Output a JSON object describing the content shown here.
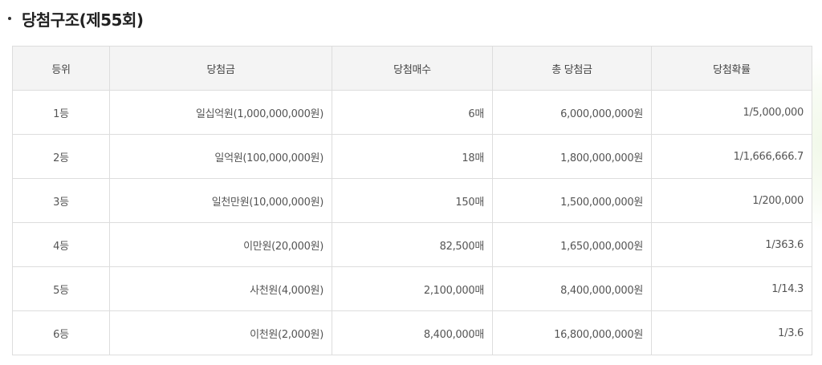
{
  "title": "당첨구조(제55회)",
  "columns": [
    "등위",
    "당첨금",
    "당첨매수",
    "총 당첨금",
    "당첨확률"
  ],
  "rows": [
    {
      "rank": "1등",
      "prize": "일십억원(1,000,000,000원)",
      "count": "6매",
      "total": "6,000,000,000원",
      "odds": "1/5,000,000"
    },
    {
      "rank": "2등",
      "prize": "일억원(100,000,000원)",
      "count": "18매",
      "total": "1,800,000,000원",
      "odds": "1/1,666,666.7"
    },
    {
      "rank": "3등",
      "prize": "일천만원(10,000,000원)",
      "count": "150매",
      "total": "1,500,000,000원",
      "odds": "1/200,000"
    },
    {
      "rank": "4등",
      "prize": "이만원(20,000원)",
      "count": "82,500매",
      "total": "1,650,000,000원",
      "odds": "1/363.6"
    },
    {
      "rank": "5등",
      "prize": "사천원(4,000원)",
      "count": "2,100,000매",
      "total": "8,400,000,000원",
      "odds": "1/14.3"
    },
    {
      "rank": "6등",
      "prize": "이천원(2,000원)",
      "count": "8,400,000매",
      "total": "16,800,000,000원",
      "odds": "1/3.6"
    }
  ]
}
